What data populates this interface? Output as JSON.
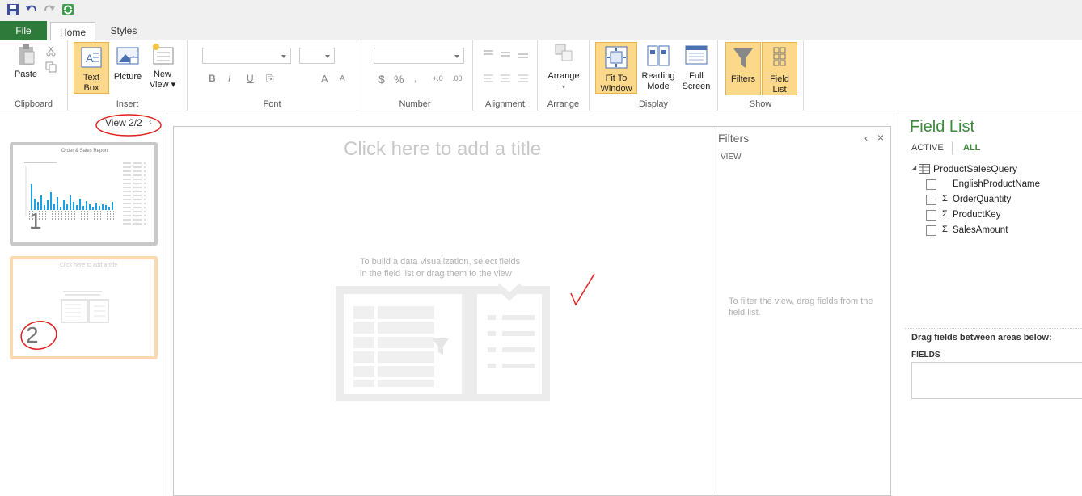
{
  "tabs": {
    "file": "File",
    "home": "Home",
    "styles": "Styles"
  },
  "ribbon": {
    "clipboard": {
      "label": "Clipboard",
      "paste": "Paste"
    },
    "insert": {
      "label": "Insert",
      "text_box_line1": "Text",
      "text_box_line2": "Box",
      "picture": "Picture",
      "new_view_line1": "New",
      "new_view_line2": "View"
    },
    "font": {
      "label": "Font",
      "bold": "B",
      "italic": "I",
      "underline": "U",
      "grow": "A",
      "shrink": "A"
    },
    "number": {
      "label": "Number",
      "currency": "$",
      "percent": "%",
      "comma": ",",
      "inc_decimal": "+.0",
      "dec_decimal": ".00"
    },
    "alignment": {
      "label": "Alignment"
    },
    "arrange": {
      "label": "Arrange",
      "arrange_btn": "Arrange"
    },
    "display": {
      "label": "Display",
      "fit_line1": "Fit To",
      "fit_line2": "Window",
      "reading_line1": "Reading",
      "reading_line2": "Mode",
      "full_line1": "Full",
      "full_line2": "Screen"
    },
    "show": {
      "label": "Show",
      "filters": "Filters",
      "field_line1": "Field",
      "field_line2": "List"
    }
  },
  "views": {
    "counter": "View  2/2",
    "items": [
      {
        "number": "1",
        "title": "Order & Sales Report"
      },
      {
        "number": "2",
        "title": "Click here to add a title"
      }
    ]
  },
  "canvas": {
    "title_placeholder": "Click here to add a title",
    "hint_line1": "To build a data visualization, select fields",
    "hint_line2": "in the field list or drag them to the view"
  },
  "filters": {
    "title": "Filters",
    "view_tab": "VIEW",
    "hint_line1": "To filter the view, drag fields from the",
    "hint_line2": "field list."
  },
  "field_list": {
    "title": "Field List",
    "tab_active": "ACTIVE",
    "tab_all": "ALL",
    "table_name": "ProductSalesQuery",
    "fields": [
      {
        "name": "EnglishProductName",
        "sigma": ""
      },
      {
        "name": "OrderQuantity",
        "sigma": "Σ"
      },
      {
        "name": "ProductKey",
        "sigma": "Σ"
      },
      {
        "name": "SalesAmount",
        "sigma": "Σ"
      }
    ],
    "drag_label": "Drag fields between areas below:",
    "fields_area": "FIELDS"
  },
  "colors": {
    "file_tab": "#2e7a3a",
    "active_btn": "#fbd88a",
    "field_list_title": "#3c8a3c",
    "annotation": "#e02020"
  }
}
